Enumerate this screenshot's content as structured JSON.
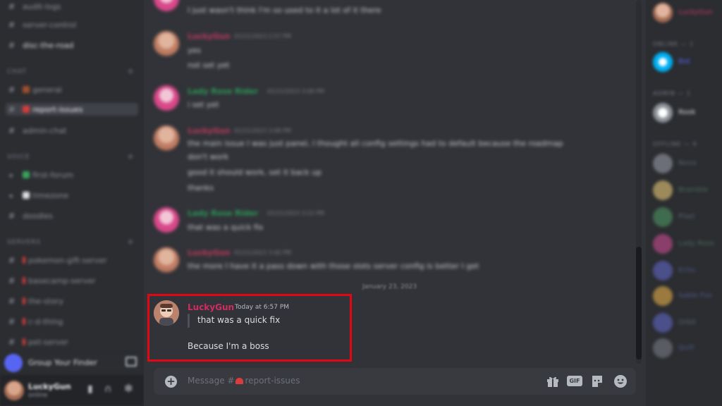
{
  "sidebar": {
    "channels": [
      {
        "label": "audit-logs"
      },
      {
        "label": "server-control"
      },
      {
        "label": "disc-the-road"
      },
      {
        "label": "general"
      },
      {
        "label": "report-issues"
      },
      {
        "label": "admin-chat"
      },
      {
        "label": "first-forum"
      },
      {
        "label": "timezone"
      },
      {
        "label": "doodles"
      },
      {
        "label": "pokemon-gift-server"
      },
      {
        "label": "basecamp-server"
      },
      {
        "label": "the-story"
      },
      {
        "label": "c-d-thing"
      },
      {
        "label": "pet-server"
      }
    ],
    "categories": [
      "CHAT",
      "VOICE",
      "SERVERS"
    ],
    "voice_bar_label": "Group Your Finder",
    "user": {
      "name": "LuckyGun",
      "status": "online"
    }
  },
  "messages": [
    {
      "author": "LuckyGun",
      "timestamp": "01/21/2023 2:57 PM",
      "lines": [
        "yes",
        "not set yet"
      ]
    },
    {
      "author": "Lady Rose Rider",
      "timestamp": "01/21/2023 3:06 PM",
      "lines": [
        "i set yet"
      ]
    },
    {
      "author": "LuckyGun",
      "timestamp": "01/21/2023 3:08 PM",
      "lines": [
        "the main issue I was just panel, I thought all config settings had to default because the roadmap",
        "don't work",
        "good it should work, set it back up",
        "thanks"
      ]
    },
    {
      "author": "Lady Rose Rider",
      "timestamp": "01/21/2023 3:22 PM",
      "lines": [
        "that was a quick fix"
      ]
    },
    {
      "author": "LuckyGun",
      "timestamp": "01/21/2023 3:40 PM",
      "lines": [
        "the more I have it a pass down with those slots server config is better I get"
      ]
    }
  ],
  "date_divider": "January 23, 2023",
  "focused_message": {
    "author": "LuckyGun",
    "timestamp": "Today at 6:57 PM",
    "quote": "that was a quick fix",
    "text": "Because I'm a boss"
  },
  "composer": {
    "placeholder_prefix": "Message #",
    "placeholder_channel": "report-issues",
    "gif_label": "GIF"
  },
  "members": {
    "top": [
      {
        "name": "LuckyGun"
      }
    ],
    "groups": [
      {
        "label": "ONLINE — 1",
        "items": [
          {
            "name": "Bot"
          }
        ]
      },
      {
        "label": "ADMIN — 1",
        "items": [
          {
            "name": "Rook"
          }
        ]
      },
      {
        "label": "OFFLINE — 9",
        "items": [
          {
            "name": "Nova"
          },
          {
            "name": "Bramble"
          },
          {
            "name": "Pixel"
          },
          {
            "name": "Lady Rose"
          },
          {
            "name": "Echo"
          },
          {
            "name": "Sable Fox"
          },
          {
            "name": "Orbit"
          },
          {
            "name": "Quill"
          }
        ]
      }
    ]
  },
  "colors": {
    "highlight_box": "#e30613",
    "username_red": "#d12c5d",
    "username_green": "#2d9b58",
    "background": "#313338"
  }
}
